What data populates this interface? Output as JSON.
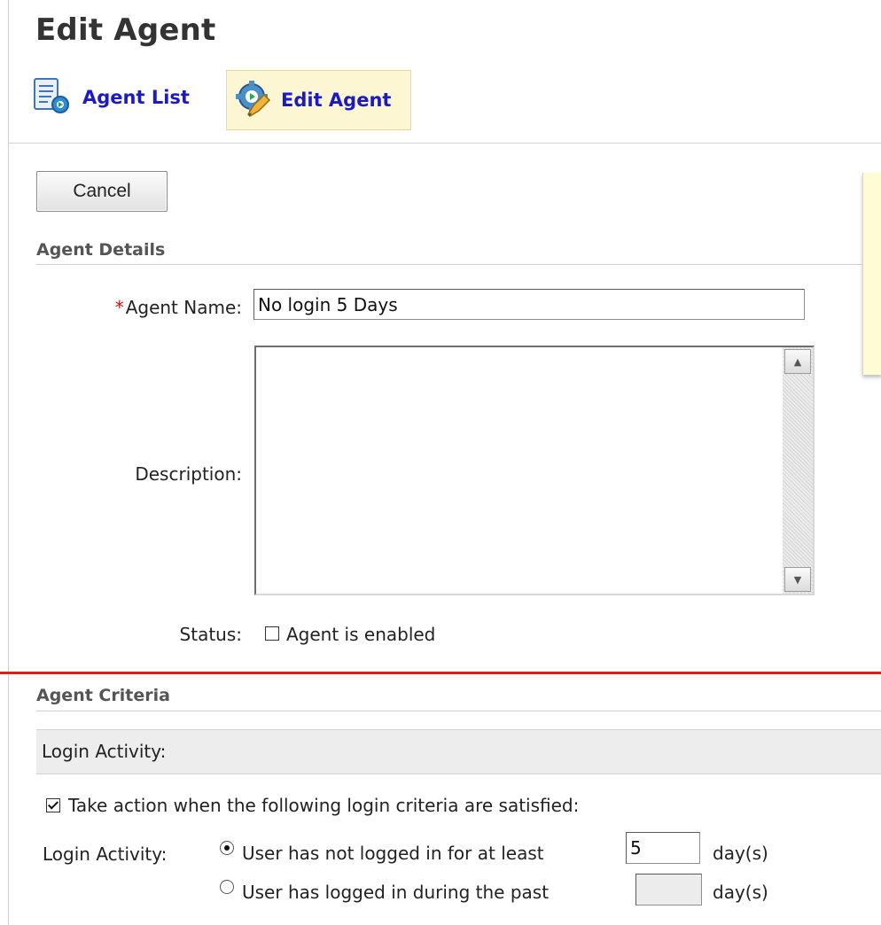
{
  "page": {
    "title": "Edit Agent"
  },
  "nav": {
    "agent_list": {
      "label": "Agent List",
      "icon": "list-settings-icon"
    },
    "edit_agent": {
      "label": "Edit Agent",
      "icon": "gear-pencil-icon",
      "active": true
    }
  },
  "toolbar": {
    "cancel_label": "Cancel"
  },
  "agent_details": {
    "heading": "Agent Details",
    "name_label": "Agent Name:",
    "required_marker": "*",
    "name_value": "No login 5 Days",
    "description_label": "Description:",
    "description_value": "",
    "status_label": "Status:",
    "status_checkbox_label": "Agent is enabled",
    "status_checked": false
  },
  "agent_criteria": {
    "heading": "Agent Criteria",
    "login_activity_bar": "Login Activity:",
    "take_action_label": "Take action when the following login criteria are satisfied:",
    "take_action_checked": true,
    "login_activity_label": "Login Activity:",
    "options": [
      {
        "label": "User has not logged in for at least",
        "value": "5",
        "unit": "day(s)",
        "selected": true
      },
      {
        "label": "User has logged in during the past",
        "value": "",
        "unit": "day(s)",
        "selected": false
      }
    ]
  },
  "colors": {
    "link": "#1a1acc",
    "active_tab_bg": "#fdf6d2",
    "required": "#dd1111",
    "annotation_line": "#e81919"
  }
}
